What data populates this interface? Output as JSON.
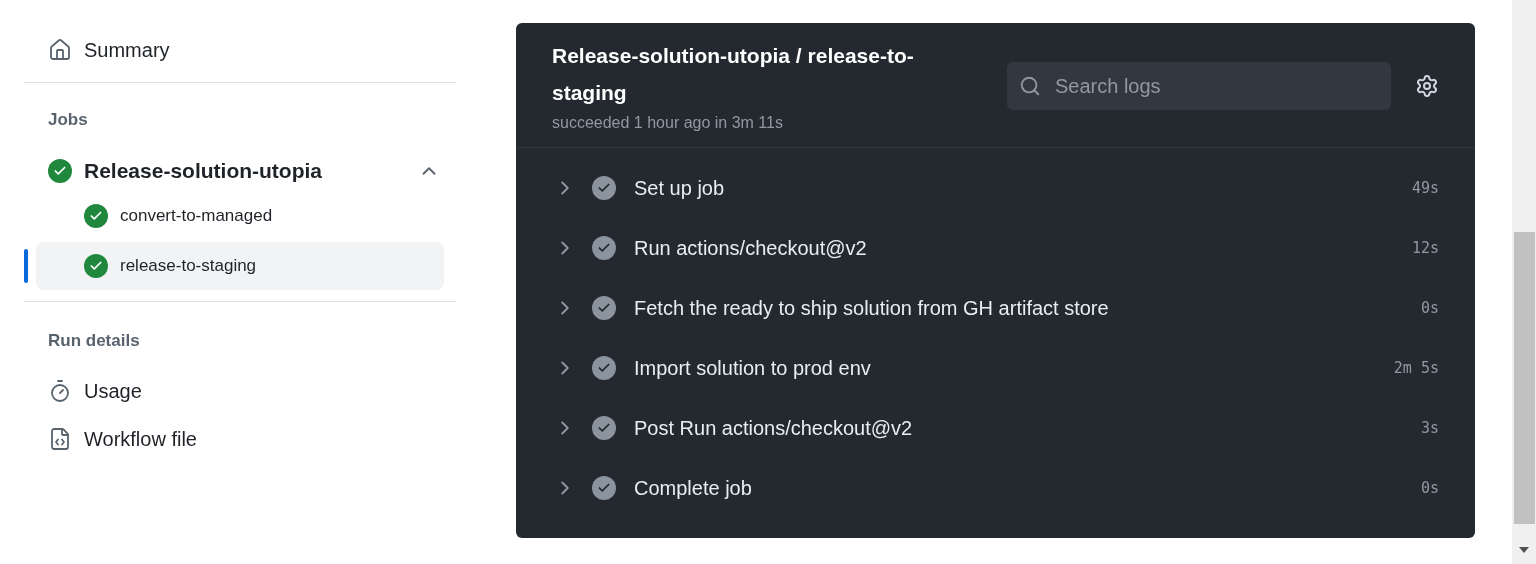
{
  "sidebar": {
    "summary": {
      "label": "Summary"
    },
    "jobs_heading": "Jobs",
    "jobs": [
      {
        "label": "Release-solution-utopia",
        "succeeded": true,
        "expanded": true,
        "children": [
          {
            "label": "convert-to-managed",
            "succeeded": true,
            "selected": false
          },
          {
            "label": "release-to-staging",
            "succeeded": true,
            "selected": true
          }
        ]
      }
    ],
    "run_details_heading": "Run details",
    "run_details": [
      {
        "label": "Usage",
        "kind": "usage"
      },
      {
        "label": "Workflow file",
        "kind": "workflow"
      }
    ]
  },
  "job_panel": {
    "title": "Release-solution-utopia / release-to-staging",
    "subtitle": "succeeded 1 hour ago in 3m 11s",
    "search": {
      "placeholder": "Search logs"
    },
    "steps": [
      {
        "name": "Set up job",
        "duration": "49s",
        "succeeded": true,
        "expanded": false
      },
      {
        "name": "Run actions/checkout@v2",
        "duration": "12s",
        "succeeded": true,
        "expanded": false
      },
      {
        "name": "Fetch the ready to ship solution from GH artifact store",
        "duration": "0s",
        "succeeded": true,
        "expanded": false
      },
      {
        "name": "Import solution to prod env",
        "duration": "2m 5s",
        "succeeded": true,
        "expanded": false
      },
      {
        "name": "Post Run actions/checkout@v2",
        "duration": "3s",
        "succeeded": true,
        "expanded": false
      },
      {
        "name": "Complete job",
        "duration": "0s",
        "succeeded": true,
        "expanded": false
      }
    ]
  }
}
